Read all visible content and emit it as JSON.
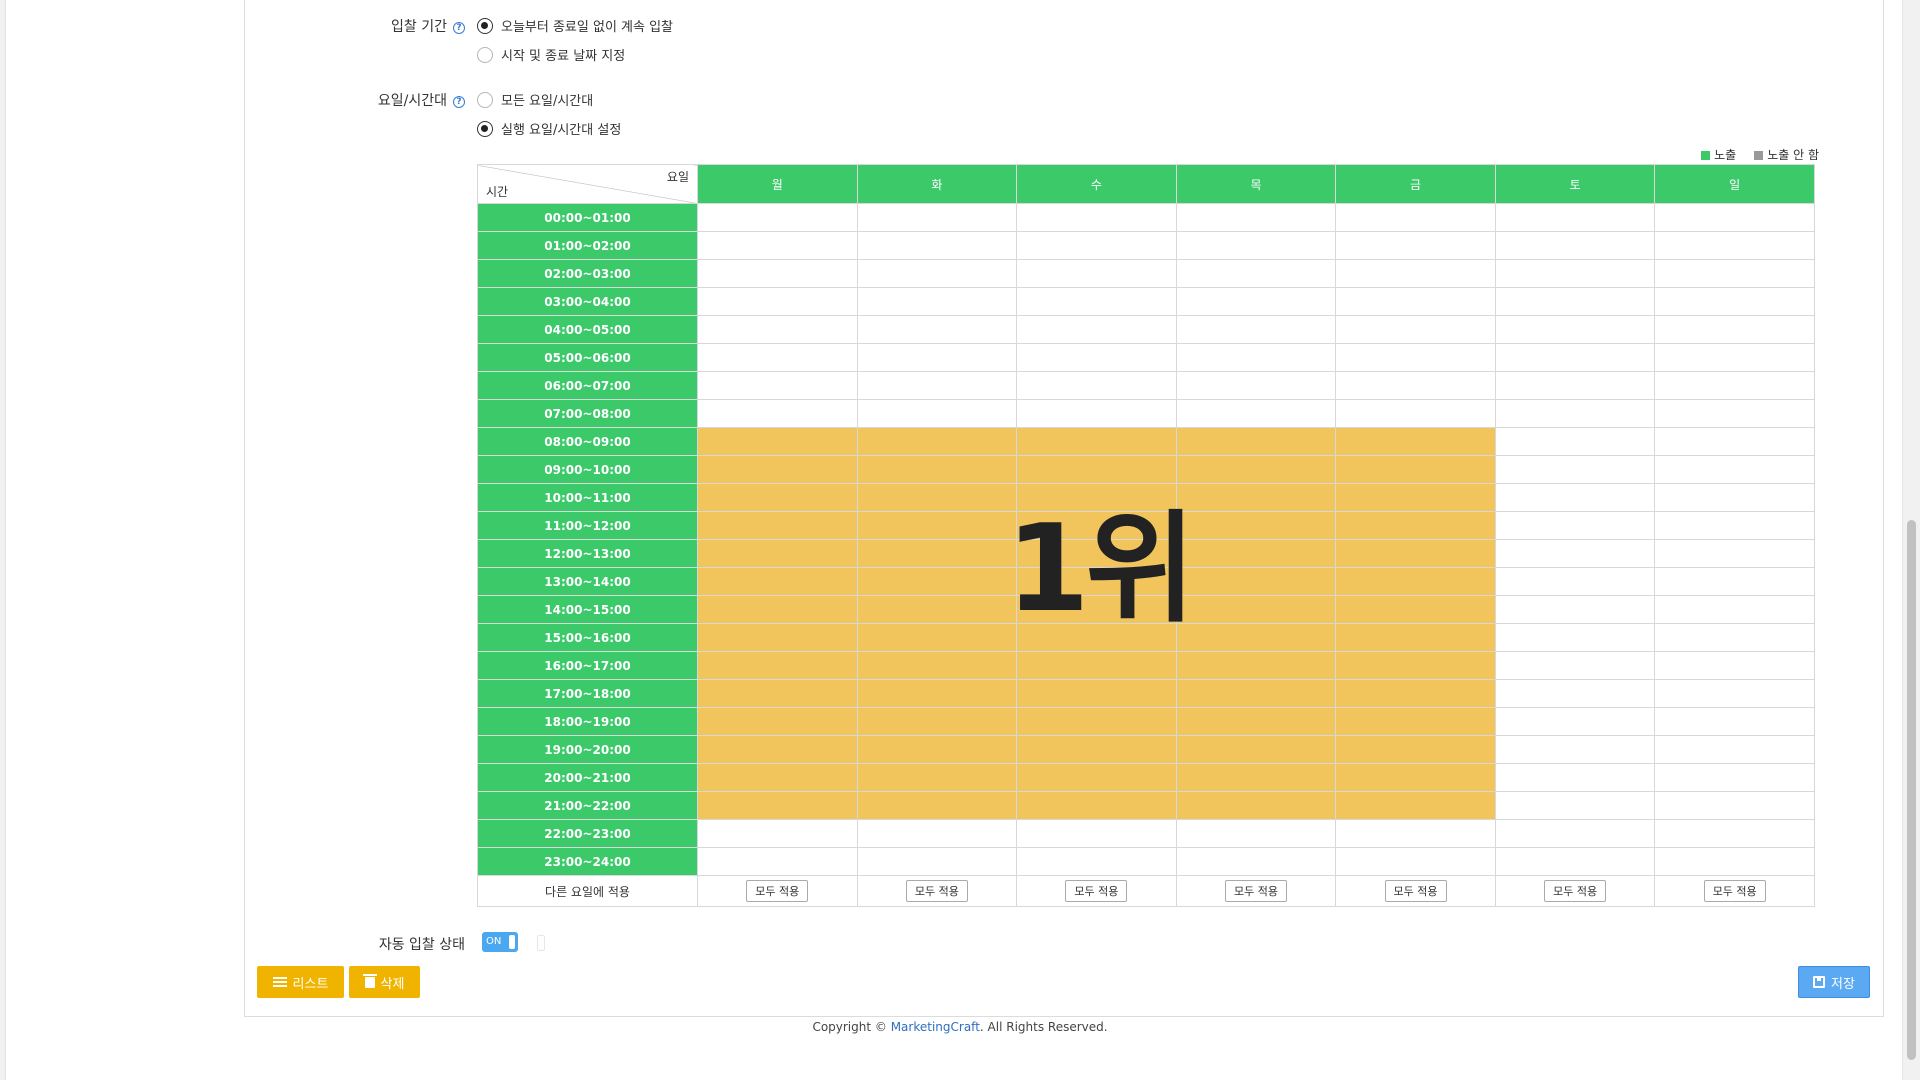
{
  "form": {
    "bid_period": {
      "label": "입찰 기간",
      "options": [
        {
          "label": "오늘부터 종료일 없이 계속 입찰",
          "selected": true
        },
        {
          "label": "시작 및 종료 날짜 지정",
          "selected": false
        }
      ]
    },
    "dayparting": {
      "label": "요일/시간대",
      "options": [
        {
          "label": "모든 요일/시간대",
          "selected": false
        },
        {
          "label": "실행 요일/시간대 설정",
          "selected": true
        }
      ]
    },
    "auto_bid": {
      "label": "자동 입찰 상태",
      "toggle": "ON",
      "enabled": true
    }
  },
  "legend": {
    "exposed": "노출",
    "not_exposed": "노출 안 함",
    "exposed_color": "#3cc96a",
    "not_exposed_color": "#999999"
  },
  "schedule": {
    "corner_day": "요일",
    "corner_time": "시간",
    "days": [
      "월",
      "화",
      "수",
      "목",
      "금",
      "토",
      "일"
    ],
    "times": [
      "00:00~01:00",
      "01:00~02:00",
      "02:00~03:00",
      "03:00~04:00",
      "04:00~05:00",
      "05:00~06:00",
      "06:00~07:00",
      "07:00~08:00",
      "08:00~09:00",
      "09:00~10:00",
      "10:00~11:00",
      "11:00~12:00",
      "12:00~13:00",
      "13:00~14:00",
      "14:00~15:00",
      "15:00~16:00",
      "16:00~17:00",
      "17:00~18:00",
      "18:00~19:00",
      "19:00~20:00",
      "20:00~21:00",
      "21:00~22:00",
      "22:00~23:00",
      "23:00~24:00"
    ],
    "selected_days": [
      "월",
      "화",
      "수",
      "목",
      "금"
    ],
    "selected_time_range": [
      "08:00~09:00",
      "21:00~22:00"
    ],
    "selected_color": "#f2c55c",
    "rank_label": "1위",
    "apply_row_label": "다른 요일에 적용",
    "apply_button_label": "모두 적용"
  },
  "buttons": {
    "list": "리스트",
    "delete": "삭제",
    "save": "저장"
  },
  "footer": {
    "prefix": "Copyright © ",
    "brand": "MarketingCraft",
    "suffix": ". All Rights Reserved."
  }
}
